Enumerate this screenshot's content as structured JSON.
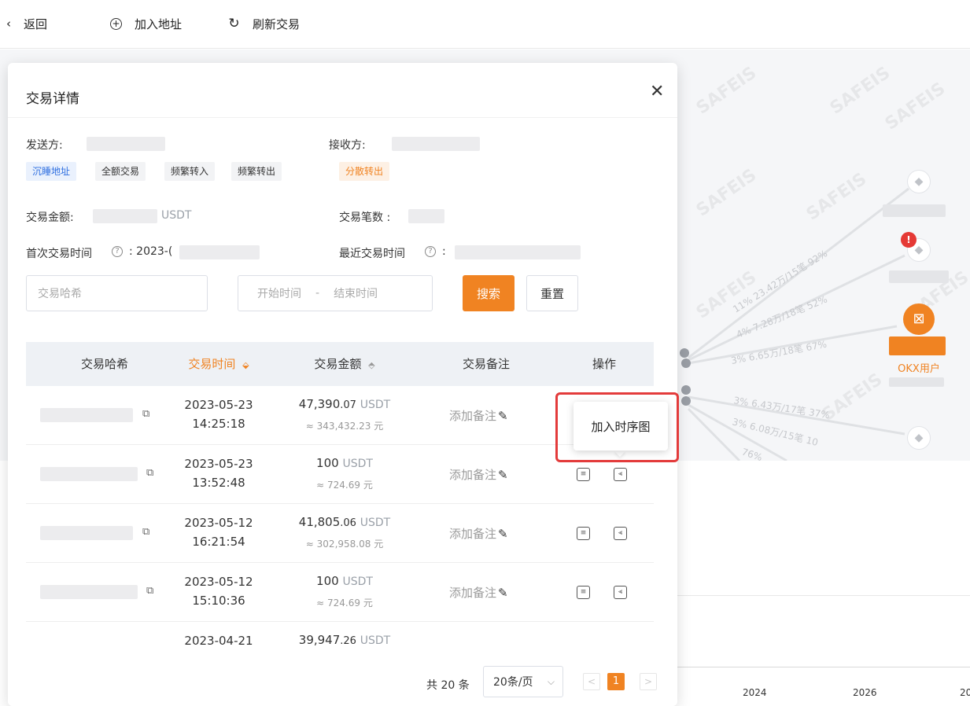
{
  "toolbar": {
    "back_label": "返回",
    "add_address_label": "加入地址",
    "refresh_label": "刷新交易"
  },
  "graph": {
    "edges": [
      "11% 23.42万/15笔 92%",
      "4% 7.28万/18笔 52%",
      "3% 6.65万/18笔 67%",
      "3% 6.43万/17笔 37%",
      "3% 6.08万/15笔 10",
      "76%"
    ],
    "okx_label": "OKX用户",
    "watermark": "SAFEIS",
    "warning_mark": "!",
    "eth_icon": "◆"
  },
  "timeline_axis": {
    "ticks": [
      "2024",
      "2026",
      "20"
    ]
  },
  "modal": {
    "title": "交易详情",
    "sender_label": "发送方:",
    "receiver_label": "接收方:",
    "sender_tags": [
      "沉睡地址",
      "全额交易",
      "频繁转入",
      "频繁转出"
    ],
    "receiver_tags": [
      "分散转出"
    ],
    "amount_label": "交易金额:",
    "amount_unit": "USDT",
    "count_label": "交易笔数 :",
    "first_time_label": "首次交易时间",
    "first_time_value": ": 2023-(",
    "last_time_label": "最近交易时间",
    "last_time_colon": ":",
    "help_icon": "?",
    "hash_placeholder": "交易哈希",
    "start_time_placeholder": "开始时间",
    "range_sep": "-",
    "end_time_placeholder": "结束时间",
    "search_label": "搜索",
    "reset_label": "重置"
  },
  "table": {
    "headers": {
      "hash": "交易哈希",
      "time": "交易时间",
      "amount": "交易金额",
      "remark": "交易备注",
      "ops": "操作"
    },
    "sort_time_glyph": "⬙",
    "sort_amount_glyph": "⬘",
    "remark_text": "添加备注",
    "remark_pencil": "✎",
    "rows": [
      {
        "date": "2023-05-23",
        "time": "14:25:18",
        "amount_int": "47,390",
        "amount_dec": ".07",
        "unit": "USDT",
        "cny": "≈ 343,432.23 元"
      },
      {
        "date": "2023-05-23",
        "time": "13:52:48",
        "amount_int": "100",
        "amount_dec": "",
        "unit": "USDT",
        "cny": "≈ 724.69 元"
      },
      {
        "date": "2023-05-12",
        "time": "16:21:54",
        "amount_int": "41,805",
        "amount_dec": ".06",
        "unit": "USDT",
        "cny": "≈ 302,958.08 元"
      },
      {
        "date": "2023-05-12",
        "time": "15:10:36",
        "amount_int": "100",
        "amount_dec": "",
        "unit": "USDT",
        "cny": "≈ 724.69 元"
      },
      {
        "date": "2023-04-21",
        "time": "",
        "amount_int": "39,947",
        "amount_dec": ".26",
        "unit": "USDT",
        "cny": ""
      }
    ]
  },
  "tooltip": {
    "text": "加入时序图"
  },
  "pager": {
    "total": "共 20 条",
    "page_size": "20条/页",
    "caret": "⌵",
    "prev": "<",
    "current": "1",
    "next": ">"
  },
  "icons": {
    "back": "‹",
    "add": "+",
    "refresh": "↻",
    "close": "✕",
    "copy": "⧉",
    "note": "≡",
    "chart": "⫷",
    "okx": "⊠"
  },
  "colors": {
    "accent": "#f08322",
    "tag_blue": "#2f6fe0",
    "highlight": "#e33b3b"
  }
}
